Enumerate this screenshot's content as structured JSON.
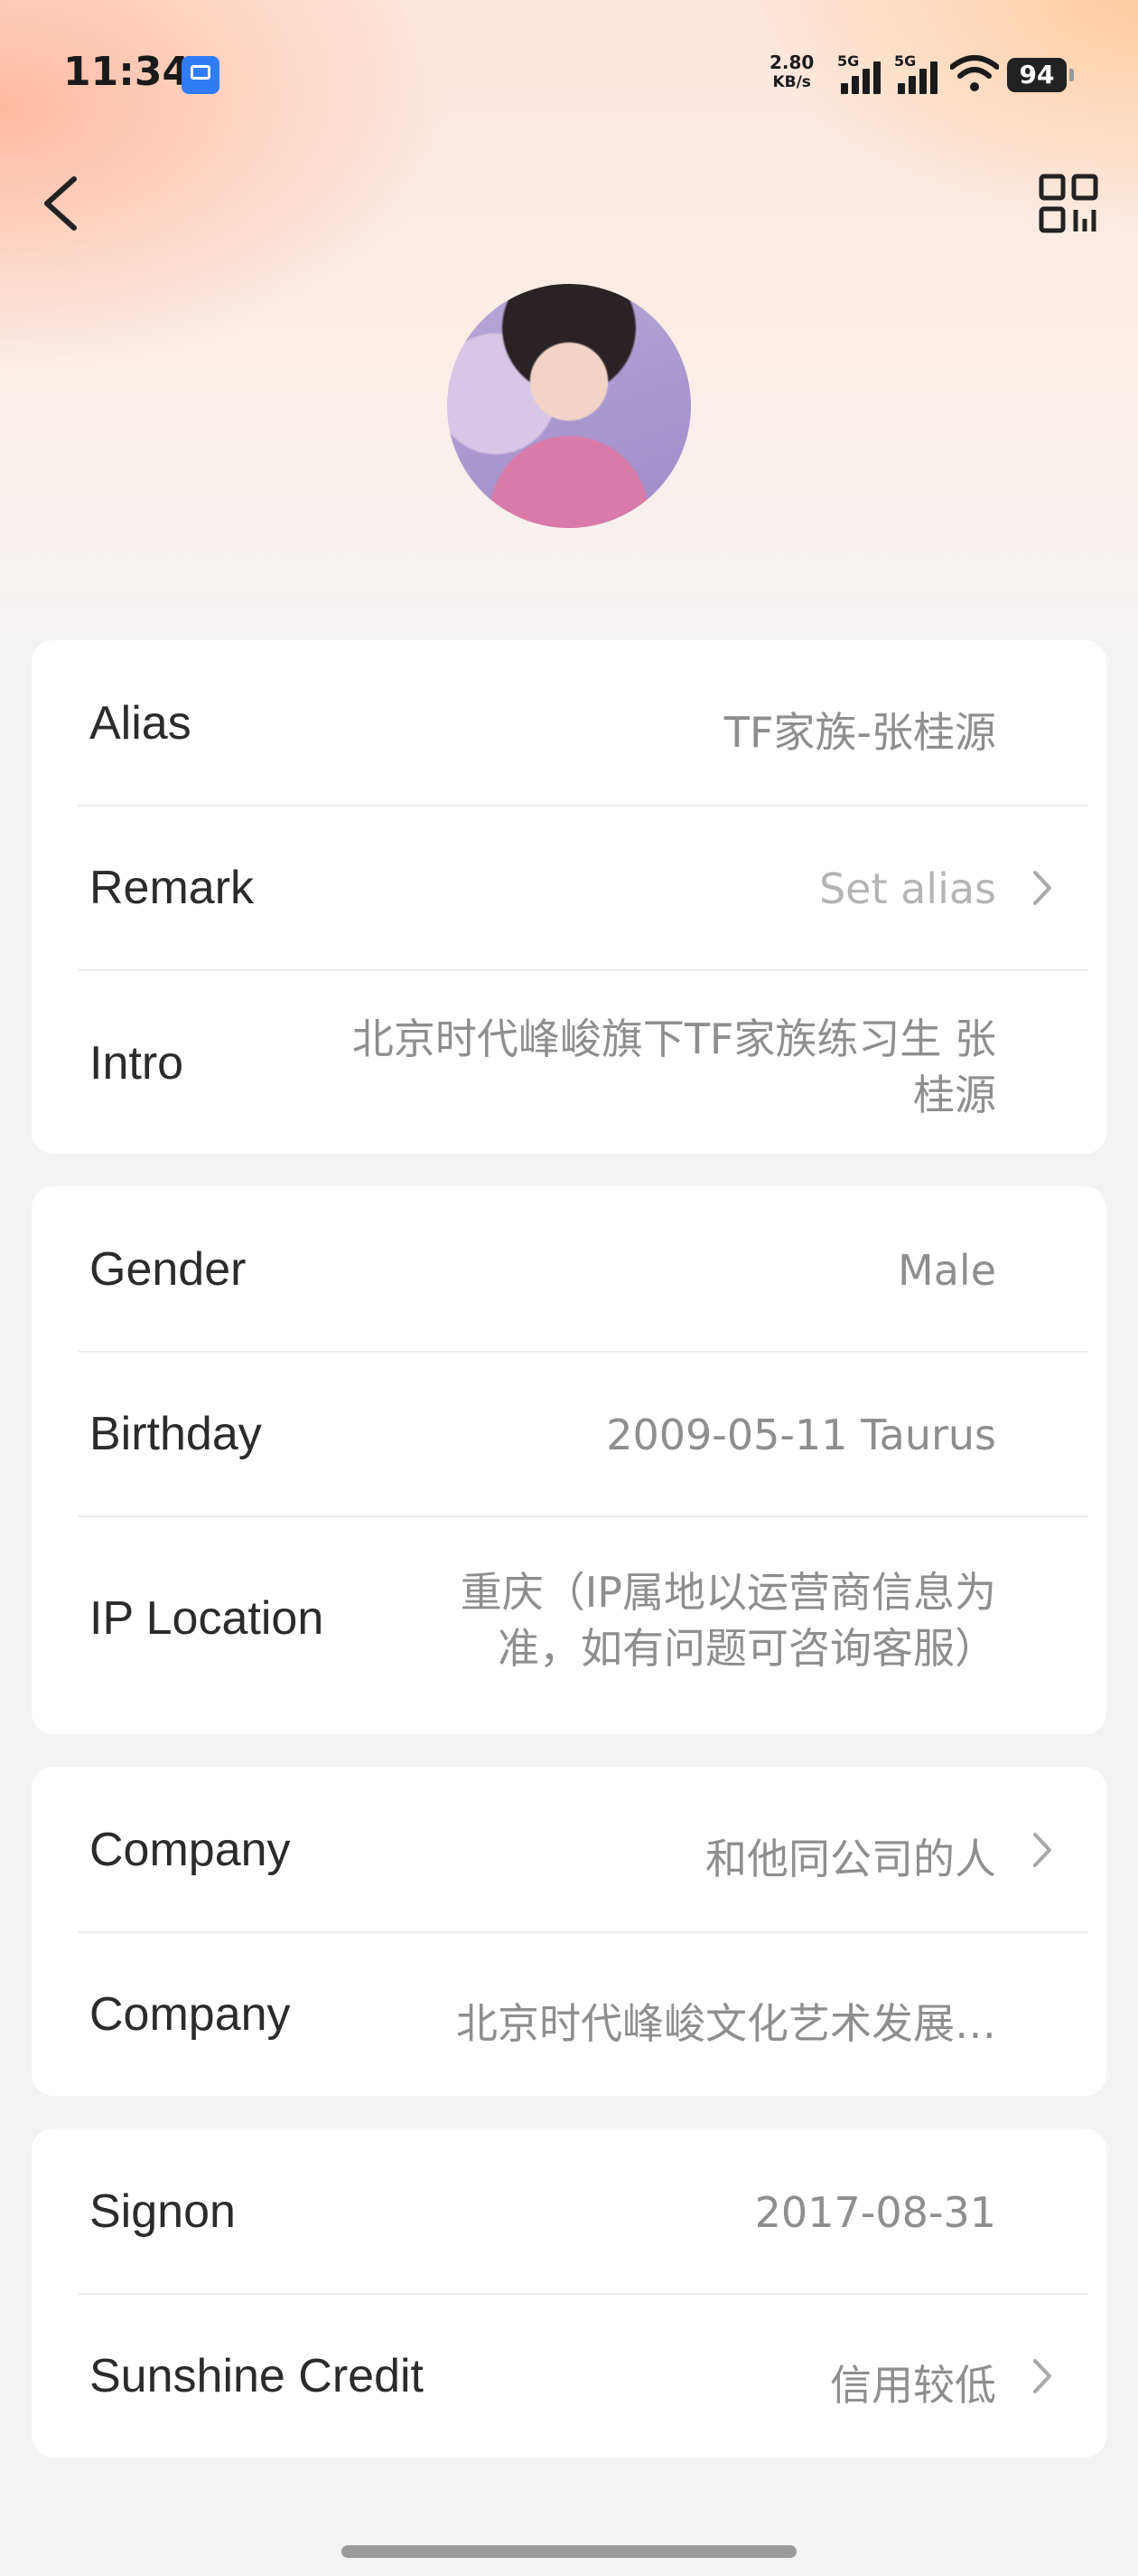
{
  "status_bar": {
    "time": "11:34",
    "net_speed_value": "2.80",
    "net_speed_unit": "KB/s",
    "sim1_label": "5G",
    "sim2_label": "5G",
    "battery": "94"
  },
  "profile": {
    "card1": {
      "alias_label": "Alias",
      "alias_value": "TF家族-张桂源",
      "remark_label": "Remark",
      "remark_value": "Set alias",
      "intro_label": "Intro",
      "intro_value_line1": "北京时代峰峻旗下TF家族练习生  张",
      "intro_value_line2": "桂源"
    },
    "card2": {
      "gender_label": "Gender",
      "gender_value": "Male",
      "birthday_label": "Birthday",
      "birthday_value": "2009-05-11 Taurus",
      "ip_label": "IP Location",
      "ip_value_line1": "重庆（IP属地以运营商信息为",
      "ip_value_line2": "准，如有问题可咨询客服）"
    },
    "card3": {
      "company1_label": "Company",
      "company1_value": "和他同公司的人",
      "company2_label": "Company",
      "company2_value": "北京时代峰峻文化艺术发展…"
    },
    "card4": {
      "signon_label": "Signon",
      "signon_value": "2017-08-31",
      "credit_label": "Sunshine Credit",
      "credit_value": "信用较低"
    }
  }
}
